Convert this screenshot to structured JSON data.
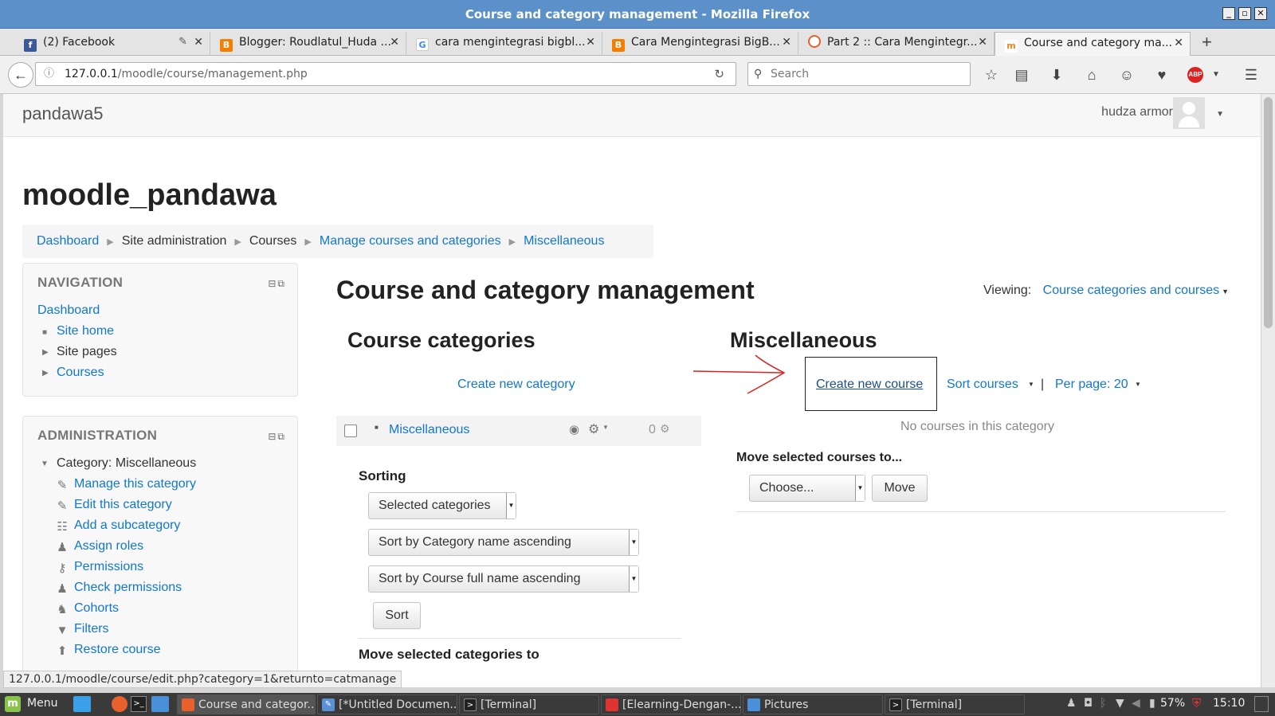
{
  "window": {
    "title": "Course and category management - Mozilla Firefox"
  },
  "tabs": [
    {
      "label": "(2) Facebook",
      "icon": "facebook-icon",
      "color": "#3b5998"
    },
    {
      "label": "Blogger: Roudlatul_Huda ...",
      "icon": "blogger-icon",
      "color": "#f57d00"
    },
    {
      "label": "cara mengintegrasi bigbl...",
      "icon": "google-icon",
      "color": "#4285f4"
    },
    {
      "label": "Cara Mengintegrasi BigB...",
      "icon": "blogger-icon",
      "color": "#f57d00"
    },
    {
      "label": "Part 2 :: Cara Mengintegr...",
      "icon": "loading-icon",
      "color": "#e8602c"
    },
    {
      "label": "Course and category ma...",
      "icon": "moodle-icon",
      "color": "#f98012"
    }
  ],
  "urlbar": {
    "host": "127.0.0.1",
    "path": "/moodle/course/management.php"
  },
  "searchbar": {
    "placeholder": "Search"
  },
  "header": {
    "brand": "pandawa5",
    "user": "hudza armor"
  },
  "site_title": "moodle_pandawa",
  "breadcrumb": [
    "Dashboard",
    "Site administration",
    "Courses",
    "Manage courses and categories",
    "Miscellaneous"
  ],
  "navigation": {
    "title": "NAVIGATION",
    "dashboard": "Dashboard",
    "items": [
      "Site home",
      "Site pages",
      "Courses"
    ]
  },
  "administration": {
    "title": "ADMINISTRATION",
    "category": "Category: Miscellaneous",
    "items": [
      {
        "label": "Manage this category",
        "icon": "pencil-icon"
      },
      {
        "label": "Edit this category",
        "icon": "pencil-icon"
      },
      {
        "label": "Add a subcategory",
        "icon": "subcategory-icon"
      },
      {
        "label": "Assign roles",
        "icon": "user-icon"
      },
      {
        "label": "Permissions",
        "icon": "key-icon"
      },
      {
        "label": "Check permissions",
        "icon": "user-check-icon"
      },
      {
        "label": "Cohorts",
        "icon": "users-icon"
      },
      {
        "label": "Filters",
        "icon": "filter-icon"
      },
      {
        "label": "Restore course",
        "icon": "restore-icon"
      }
    ]
  },
  "main": {
    "title": "Course and category management",
    "viewing_label": "Viewing:",
    "viewing_value": "Course categories and courses",
    "categories": {
      "heading": "Course categories",
      "create_link": "Create new category",
      "row": {
        "name": "Miscellaneous",
        "count": "0"
      },
      "sorting_label": "Sorting",
      "select_categories": "Selected categories",
      "sort_category": "Sort by Category name ascending",
      "sort_course": "Sort by Course full name ascending",
      "sort_button": "Sort",
      "move_label": "Move selected categories to"
    },
    "courses": {
      "heading": "Miscellaneous",
      "create_link": "Create new course",
      "sort_link": "Sort courses",
      "separator": "|",
      "perpage_link": "Per page: 20",
      "empty": "No courses in this category",
      "move_label": "Move selected courses to...",
      "choose": "Choose...",
      "move_button": "Move"
    }
  },
  "statusbar": {
    "url": "127.0.0.1/moodle/course/edit.php?category=1&returnto=catmanage"
  },
  "taskbar": {
    "menu": "Menu",
    "tasks": [
      {
        "label": "Course and categor...",
        "color": "#e8602c",
        "active": true
      },
      {
        "label": "[*Untitled Documen...",
        "color": "#5b8fd6"
      },
      {
        "label": "[Terminal]",
        "color": "#222222"
      },
      {
        "label": "[Elearning-Dengan-...",
        "color": "#d33"
      },
      {
        "label": "Pictures",
        "color": "#4a90d9"
      },
      {
        "label": "[Terminal]",
        "color": "#222222"
      }
    ],
    "battery": "57%",
    "time": "15:10"
  },
  "colors": {
    "link": "#1177d1",
    "titlebar": "#5b91c8",
    "annotation": "#e02020"
  }
}
